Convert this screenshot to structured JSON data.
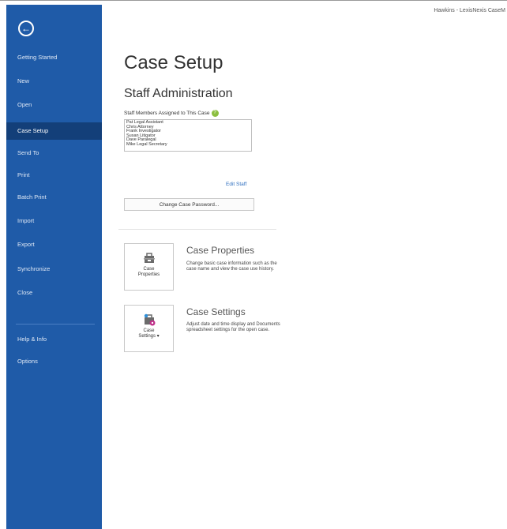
{
  "window": {
    "title": "Hawkins - LexisNexis CaseM"
  },
  "sidebar": {
    "items": [
      {
        "label": "Getting Started",
        "active": false
      },
      {
        "label": "New",
        "active": false
      },
      {
        "label": "Open",
        "active": false
      },
      {
        "label": "Case Setup",
        "active": true
      },
      {
        "label": "Send To",
        "active": false
      },
      {
        "label": "Print",
        "active": false
      },
      {
        "label": "Batch Print",
        "active": false
      },
      {
        "label": "Import",
        "active": false
      },
      {
        "label": "Export",
        "active": false
      },
      {
        "label": "Synchronize",
        "active": false
      },
      {
        "label": "Close",
        "active": false
      },
      {
        "label": "Help & Info",
        "active": false
      },
      {
        "label": "Options",
        "active": false
      }
    ]
  },
  "main": {
    "title": "Case Setup",
    "staff": {
      "heading": "Staff Administration",
      "label": "Staff Members Assigned to This Case",
      "members": [
        "Pat Legal Assistant",
        "Chris Attorney",
        "Frank Investigator",
        "Susan Litigator",
        "Dave Paralegal",
        "Mike Legal Secretary"
      ],
      "edit_label": "Edit Staff",
      "password_button": "Change Case Password..."
    },
    "properties": {
      "tile_label": [
        "Case",
        "Properties"
      ],
      "title": "Case Properties",
      "desc": "Change basic case information such as the case name and view the case use history."
    },
    "settings": {
      "tile_label": [
        "Case",
        "Settings ▾"
      ],
      "title": "Case Settings",
      "desc": "Adjust date and time display and Documents spreadsheet settings for the open case."
    }
  },
  "colors": {
    "sidebar": "#1f5ba8",
    "sidebar_active": "#133f79",
    "link": "#2f6fbf"
  }
}
